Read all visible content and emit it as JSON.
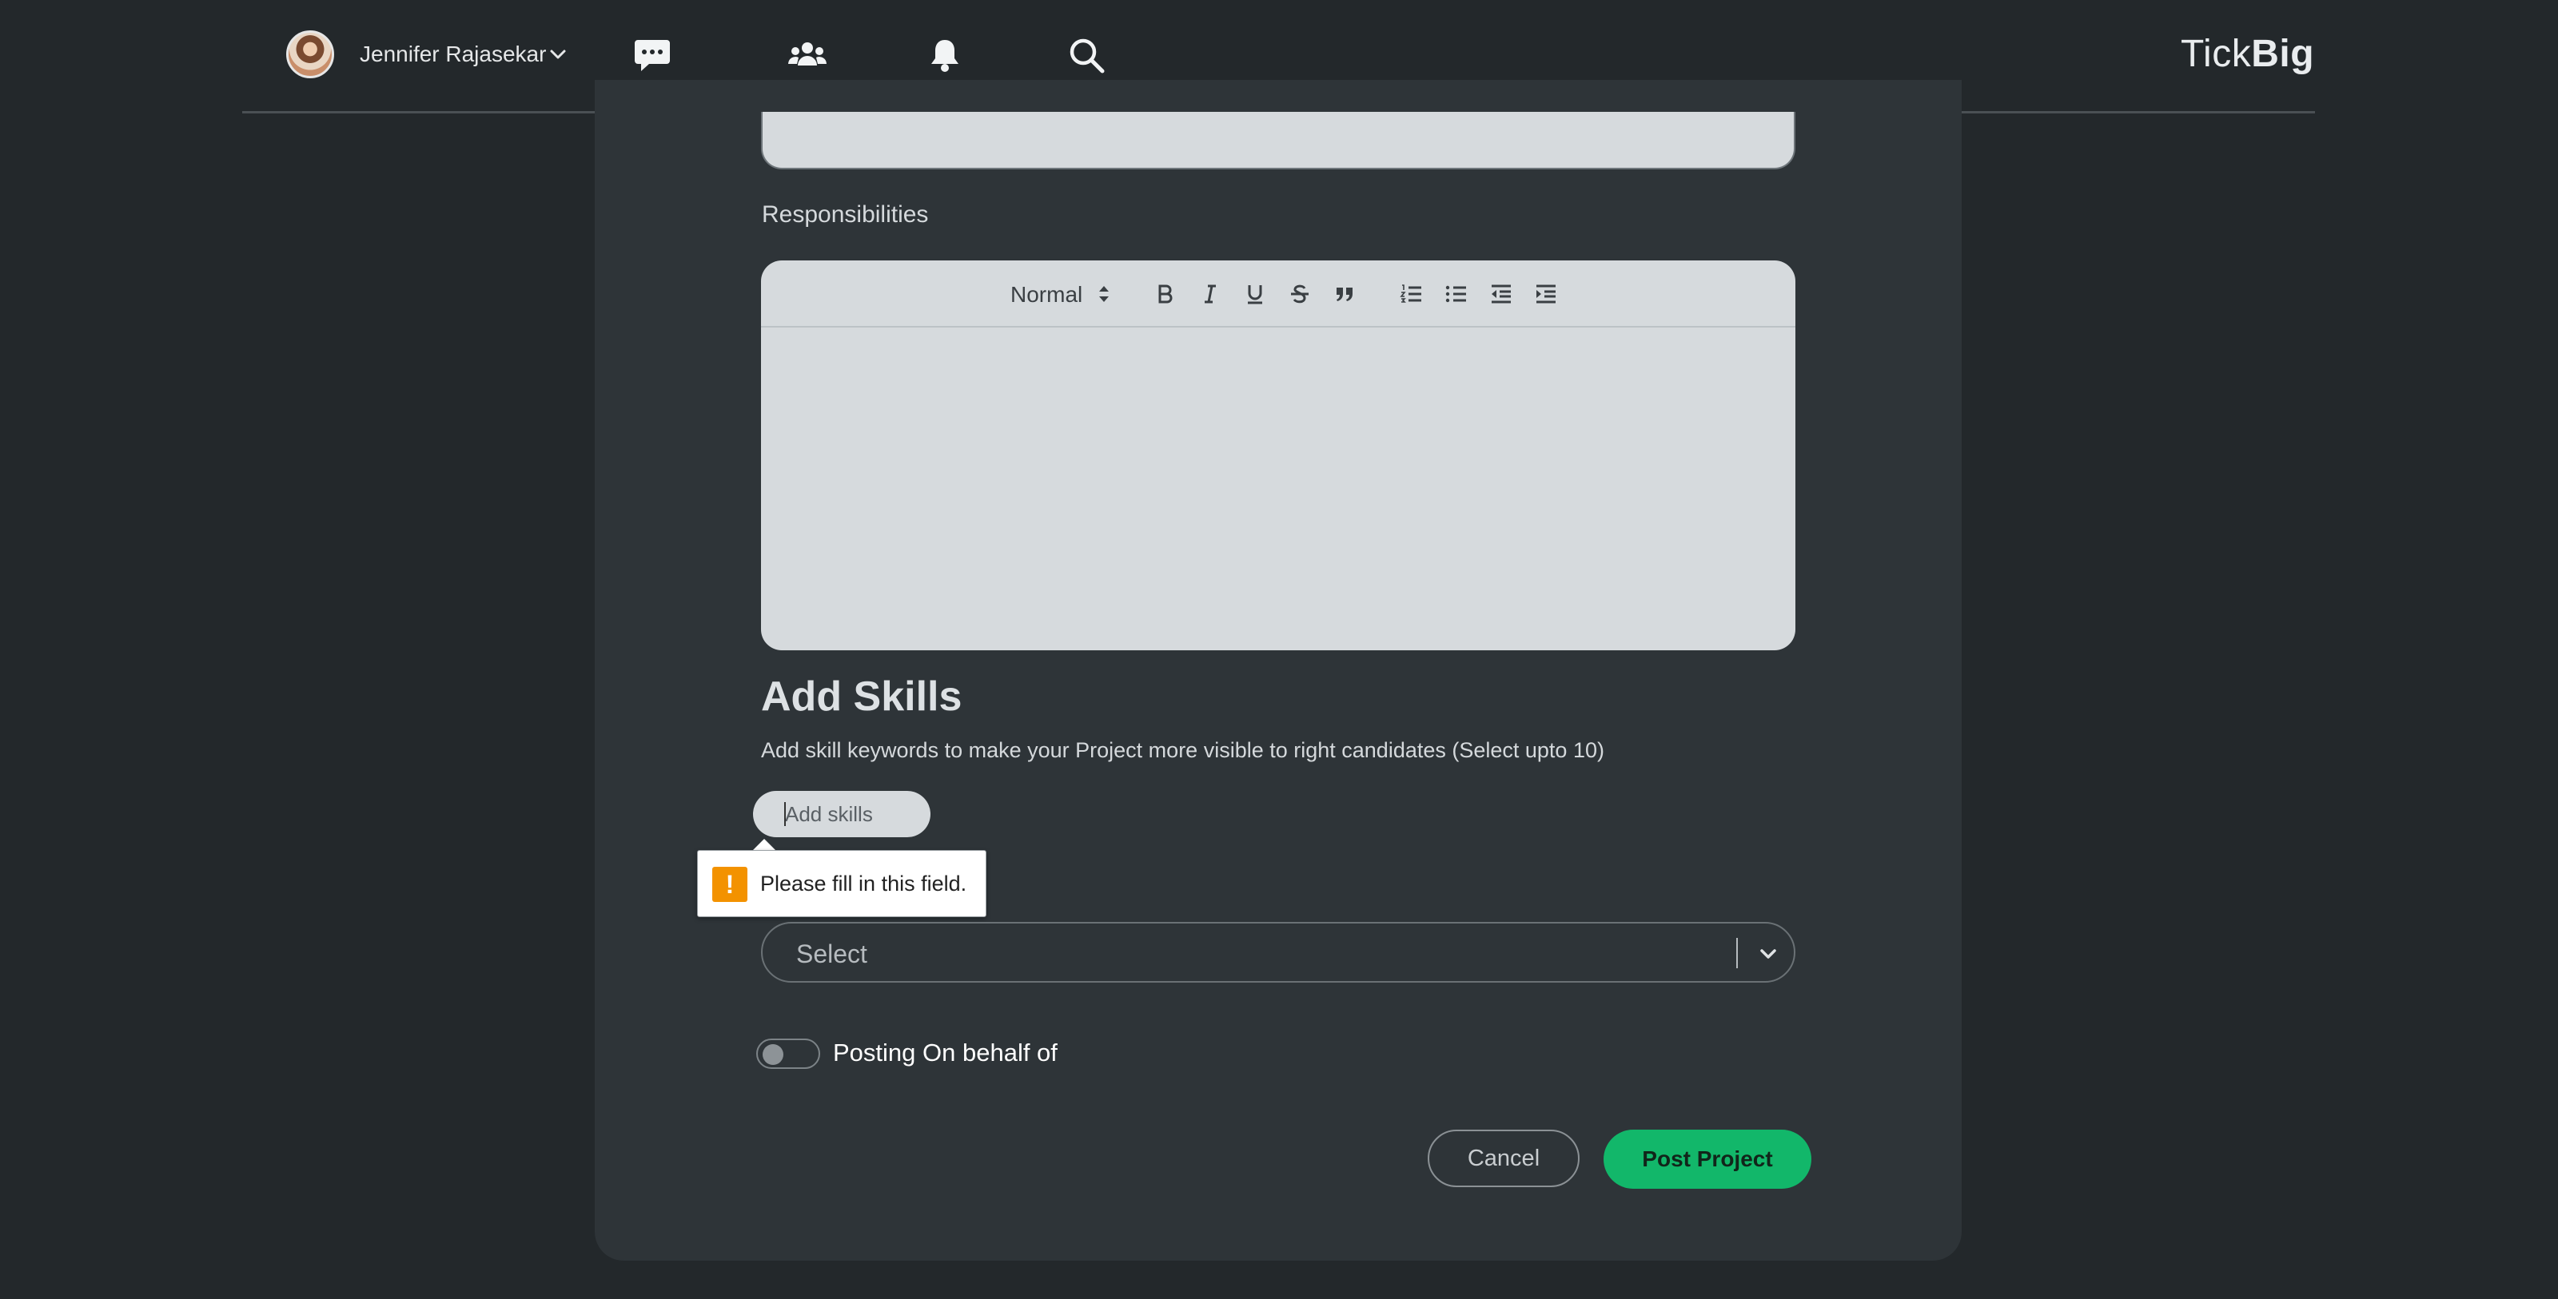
{
  "header": {
    "user_name": "Jennifer Rajasekar",
    "brand_light": "Tick",
    "brand_bold": "Big",
    "icons": [
      "chat-icon",
      "users-icon",
      "bell-icon",
      "search-icon"
    ]
  },
  "form": {
    "responsibilities_label": "Responsibilities",
    "editor_toolbar": {
      "format_label": "Normal",
      "buttons": [
        "bold",
        "italic",
        "underline",
        "strikethrough",
        "blockquote",
        "ordered-list",
        "bullet-list",
        "outdent",
        "indent"
      ]
    },
    "skills": {
      "title": "Add Skills",
      "description": "Add skill keywords to make your Project more visible to right candidates (Select upto 10)",
      "input_placeholder": "Add skills"
    },
    "validation_tooltip": "Please fill in this field.",
    "select_placeholder": "Select",
    "posting_on_behalf_label": "Posting On behalf of",
    "posting_on_behalf_enabled": false,
    "cancel_label": "Cancel",
    "post_label": "Post Project"
  },
  "colors": {
    "background": "#23282b",
    "card": "#2e3438",
    "field": "#d6dadd",
    "primary": "#12b76a",
    "warning": "#f39200"
  }
}
